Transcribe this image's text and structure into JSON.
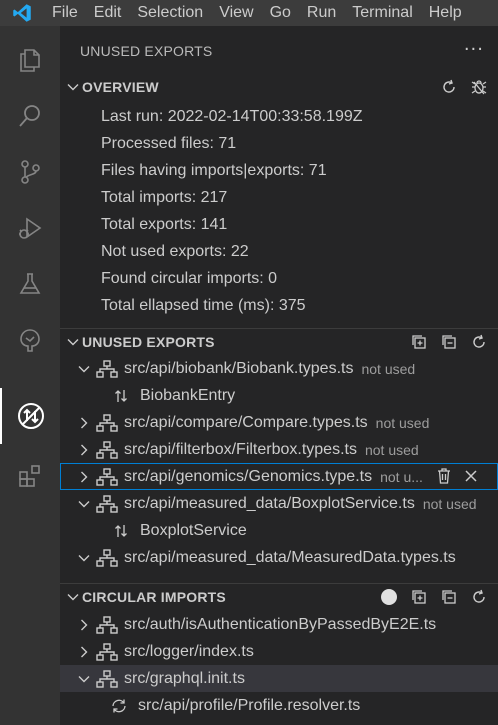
{
  "menubar": {
    "items": [
      "File",
      "Edit",
      "Selection",
      "View",
      "Go",
      "Run",
      "Terminal",
      "Help"
    ]
  },
  "activity_bar": {
    "items": [
      "explorer-icon",
      "search-icon",
      "source-control-icon",
      "run-debug-icon",
      "testing-icon",
      "remote-explorer-icon",
      "unused-exports-icon",
      "extensions-icon"
    ],
    "active": "unused-exports-icon"
  },
  "sidebar": {
    "title": "UNUSED EXPORTS",
    "more_label": "···"
  },
  "overview": {
    "label": "OVERVIEW",
    "lines": [
      "Last run: 2022-02-14T00:33:58.199Z",
      "Processed files: 71",
      "Files having imports|exports: 71",
      "Total imports: 217",
      "Total exports: 141",
      "Not used exports: 22",
      "Found circular imports: 0",
      "Total ellapsed time (ms): 375"
    ]
  },
  "unused_exports": {
    "label": "UNUSED EXPORTS",
    "rows": [
      {
        "path": "src/api/biobank/Biobank.types.ts",
        "desc": "not used",
        "expanded": true
      },
      {
        "child": "BiobankEntry"
      },
      {
        "path": "src/api/compare/Compare.types.ts",
        "desc": "not used",
        "expanded": false
      },
      {
        "path": "src/api/filterbox/Filterbox.types.ts",
        "desc": "not used",
        "expanded": false
      },
      {
        "path": "src/api/genomics/Genomics.type.ts",
        "desc": "not u...",
        "expanded": false,
        "focused": true
      },
      {
        "path": "src/api/measured_data/BoxplotService.ts",
        "desc": "not used",
        "expanded": true
      },
      {
        "child": "BoxplotService"
      },
      {
        "path": "src/api/measured_data/MeasuredData.types.ts",
        "desc": "",
        "expanded": true
      }
    ]
  },
  "circular_imports": {
    "label": "CIRCULAR IMPORTS",
    "rows": [
      {
        "path": "src/auth/isAuthenticationByPassedByE2E.ts",
        "expanded": false
      },
      {
        "path": "src/logger/index.ts",
        "expanded": false
      },
      {
        "path": "src/graphql.init.ts",
        "expanded": true,
        "selected": true
      },
      {
        "child": "src/api/profile/Profile.resolver.ts"
      }
    ]
  },
  "colors": {
    "titlebar": "#3c3c3c",
    "activitybar": "#333333",
    "sidebar": "#252526",
    "focus": "#007fd4",
    "vscode_blue": "#23a9f2"
  }
}
